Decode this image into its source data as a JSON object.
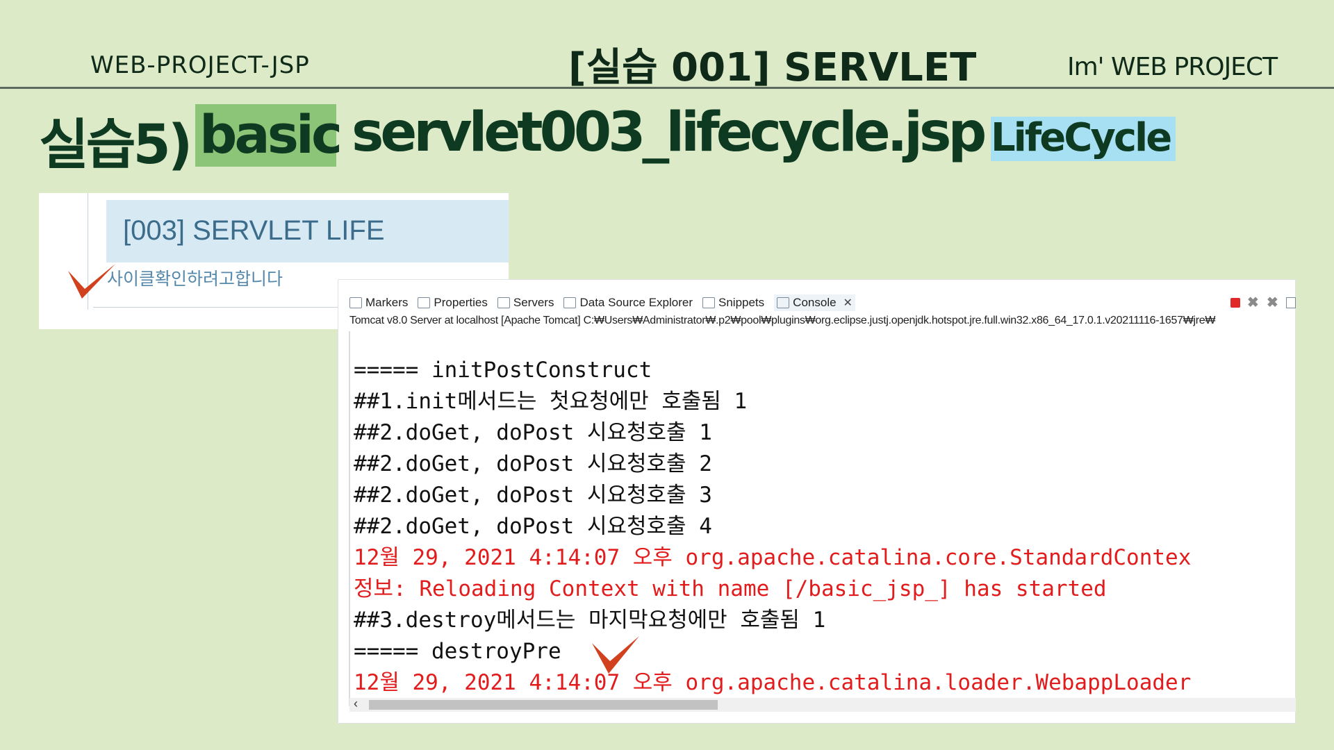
{
  "slide": {
    "header_left": "WEB-PROJECT-JSP",
    "header_center": "[실습 001]  SERVLET",
    "header_right": "Im'  WEB PROJECT",
    "title_prefix": "실습5)",
    "title_basic": "basic",
    "title_file": "servlet003_lifecycle.jsp",
    "title_tag": "LifeCycle",
    "colors": {
      "background": "#dceac8",
      "basic_highlight": "#8cc578",
      "lifecycle_highlight": "#a8e0f3",
      "check_mark": "#d2411e"
    }
  },
  "browser": {
    "heading": "[003] SERVLET LIFE",
    "subtext": "사이클확인하려고합니다"
  },
  "console": {
    "tabs": [
      {
        "label": "Markers",
        "icon": "markers-icon"
      },
      {
        "label": "Properties",
        "icon": "properties-icon"
      },
      {
        "label": "Servers",
        "icon": "servers-icon"
      },
      {
        "label": "Data Source Explorer",
        "icon": "data-source-icon"
      },
      {
        "label": "Snippets",
        "icon": "snippets-icon"
      },
      {
        "label": "Console",
        "icon": "console-icon",
        "active": true
      }
    ],
    "path": "Tomcat v8.0 Server at localhost [Apache Tomcat] C:₩Users₩Administrator₩.p2₩pool₩plugins₩org.eclipse.justj.openjdk.hotspot.jre.full.win32.x86_64_17.0.1.v20211116-1657₩jre₩",
    "lines": [
      {
        "text": "===== initPostConstruct",
        "error": false
      },
      {
        "text": "##1.init메서드는 첫요청에만 호출됨 1",
        "error": false
      },
      {
        "text": "##2.doGet, doPost 시요청호출 1",
        "error": false
      },
      {
        "text": "##2.doGet, doPost 시요청호출 2",
        "error": false
      },
      {
        "text": "##2.doGet, doPost 시요청호출 3",
        "error": false
      },
      {
        "text": "##2.doGet, doPost 시요청호출 4",
        "error": false
      },
      {
        "text": "12월 29, 2021 4:14:07 오후 org.apache.catalina.core.StandardContex",
        "error": true
      },
      {
        "text": "정보: Reloading Context with name [/basic_jsp_] has started",
        "error": true
      },
      {
        "text": "##3.destroy메서드는 마지막요청에만 호출됨 1",
        "error": false
      },
      {
        "text": "===== destroyPre",
        "error": false
      },
      {
        "text": "12월 29, 2021 4:14:07 오후 org.apache.catalina.loader.WebappLoader",
        "error": true
      }
    ]
  }
}
